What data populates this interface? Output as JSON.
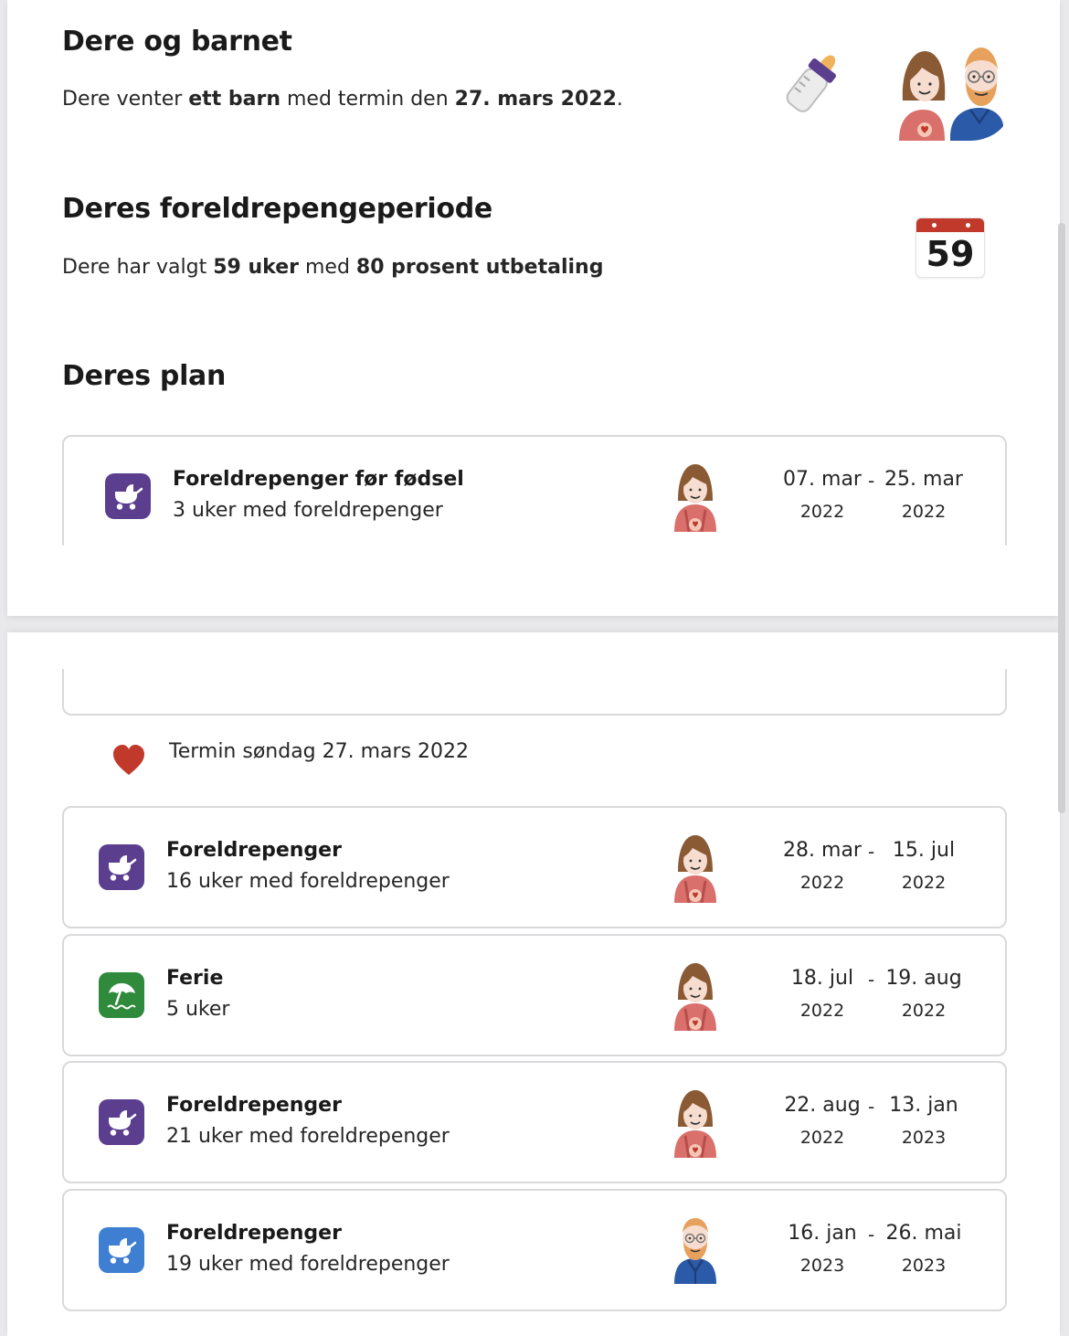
{
  "section1": {
    "title": "Dere og barnet",
    "text_prefix": "Dere venter ",
    "text_bold1": "ett barn",
    "text_mid": " med termin den ",
    "text_bold2": "27. mars 2022",
    "text_suffix": "."
  },
  "section2": {
    "title": "Deres foreldrepengeperiode",
    "text_prefix": "Dere har valgt ",
    "text_bold1": "59 uker",
    "text_mid": " med ",
    "text_bold2": "80 prosent utbetaling",
    "calendar_number": "59"
  },
  "section3": {
    "title": "Deres plan"
  },
  "termin": {
    "label": "Termin søndag 27. mars 2022"
  },
  "periods": [
    {
      "title": "Foreldrepenger før fødsel",
      "subtitle": "3 uker med foreldrepenger",
      "type": "stroller-icon",
      "color": "#5b3f8e",
      "person": "mother",
      "from_date": "07. mar",
      "from_year": "2022",
      "to_date": "25. mar",
      "to_year": "2022",
      "dash": "-"
    },
    {
      "title": "Foreldrepenger",
      "subtitle": "16 uker med foreldrepenger",
      "type": "stroller-icon",
      "color": "#5b3f8e",
      "person": "mother",
      "from_date": "28. mar",
      "from_year": "2022",
      "to_date": "15. jul",
      "to_year": "2022",
      "dash": "-"
    },
    {
      "title": "Ferie",
      "subtitle": "5 uker",
      "type": "beach-umbrella-icon",
      "color": "#2f8a3c",
      "person": "mother",
      "from_date": "18. jul",
      "from_year": "2022",
      "to_date": "19. aug",
      "to_year": "2022",
      "dash": "-"
    },
    {
      "title": "Foreldrepenger",
      "subtitle": "21 uker med foreldrepenger",
      "type": "stroller-icon",
      "color": "#5b3f8e",
      "person": "mother",
      "from_date": "22. aug",
      "from_year": "2022",
      "to_date": "13. jan",
      "to_year": "2023",
      "dash": "-"
    },
    {
      "title": "Foreldrepenger",
      "subtitle": "19 uker med foreldrepenger",
      "type": "stroller-icon",
      "color": "#3f7fd1",
      "person": "father",
      "from_date": "16. jan",
      "from_year": "2023",
      "to_date": "26. mai",
      "to_year": "2023",
      "dash": "-"
    }
  ]
}
